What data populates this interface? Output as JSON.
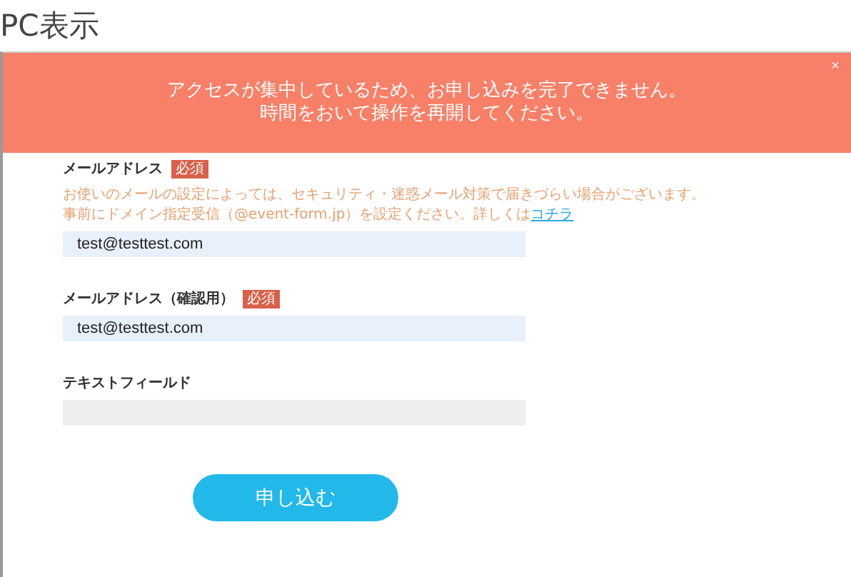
{
  "page_title": "PC表示",
  "alert": {
    "message_lines": [
      "アクセスが集中しているため、お申し込みを完了できません。",
      "時間をおいて操作を再開してください。"
    ],
    "close": "×"
  },
  "fields": [
    {
      "label": "メールアドレス",
      "required_badge": "必須",
      "hint": "お使いのメールの設定によっては、セキュリティ・迷惑メール対策で届きづらい場合がございます。",
      "hint_line2": "事前にドメイン指定受信（@event-form.jp）を設定ください。詳しくは",
      "hint_link": "コチラ",
      "value": "test@testtest.com",
      "disabled": false
    },
    {
      "label": "メールアドレス（確認用）",
      "required_badge": "必須",
      "value": "test@testtest.com",
      "disabled": false
    },
    {
      "label": "テキストフィールド",
      "disabled": true
    }
  ],
  "submit": "申し込む"
}
